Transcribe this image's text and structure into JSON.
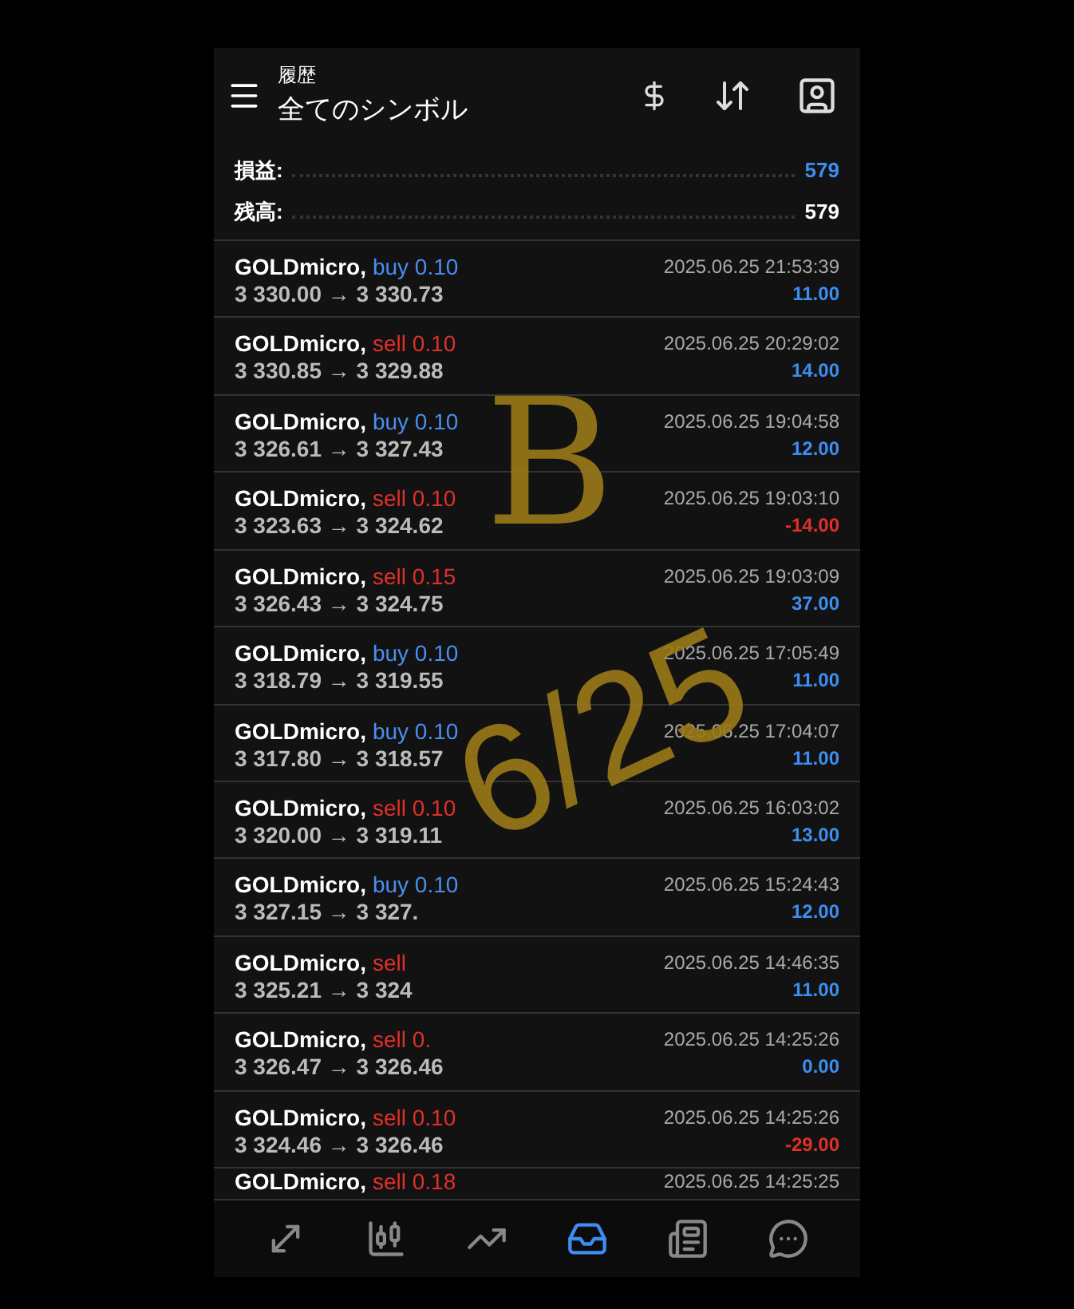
{
  "header": {
    "subtitle": "履歴",
    "title": "全てのシンボル"
  },
  "summary": [
    {
      "label": "損益:",
      "value": "579",
      "kind": "profit"
    },
    {
      "label": "残高:",
      "value": "579",
      "kind": "balance"
    }
  ],
  "deals": [
    {
      "symbol": "GOLDmicro,",
      "buy": true,
      "order": "buy 0.10",
      "prices": "3 330.00 → 3 330.73",
      "time": "2025.06.25 21:53:39",
      "profit": "11.00",
      "loss": false
    },
    {
      "symbol": "GOLDmicro,",
      "buy": false,
      "order": "sell 0.10",
      "prices": "3 330.85 → 3 329.88",
      "time": "2025.06.25 20:29:02",
      "profit": "14.00",
      "loss": false
    },
    {
      "symbol": "GOLDmicro,",
      "buy": true,
      "order": "buy 0.10",
      "prices": "3 326.61 → 3 327.43",
      "time": "2025.06.25 19:04:58",
      "profit": "12.00",
      "loss": false
    },
    {
      "symbol": "GOLDmicro,",
      "buy": false,
      "order": "sell 0.10",
      "prices": "3 323.63 → 3 324.62",
      "time": "2025.06.25 19:03:10",
      "profit": "-14.00",
      "loss": true
    },
    {
      "symbol": "GOLDmicro,",
      "buy": false,
      "order": "sell 0.15",
      "prices": "3 326.43 → 3 324.75",
      "time": "2025.06.25 19:03:09",
      "profit": "37.00",
      "loss": false
    },
    {
      "symbol": "GOLDmicro,",
      "buy": true,
      "order": "buy 0.10",
      "prices": "3 318.79 → 3 319.55",
      "time": "2025.06.25 17:05:49",
      "profit": "11.00",
      "loss": false
    },
    {
      "symbol": "GOLDmicro,",
      "buy": true,
      "order": "buy 0.10",
      "prices": "3 317.80 → 3 318.57",
      "time": "2025.06.25 17:04:07",
      "profit": "11.00",
      "loss": false
    },
    {
      "symbol": "GOLDmicro,",
      "buy": false,
      "order": "sell 0.10",
      "prices": "3 320.00 → 3 319.11",
      "time": "2025.06.25 16:03:02",
      "profit": "13.00",
      "loss": false
    },
    {
      "symbol": "GOLDmicro,",
      "buy": true,
      "order": "buy 0.10",
      "prices": "3 327.15 → 3 327.",
      "time": "2025.06.25 15:24:43",
      "profit": "12.00",
      "loss": false
    },
    {
      "symbol": "GOLDmicro,",
      "buy": false,
      "order": "sell",
      "prices": "3 325.21 → 3 324",
      "time": "2025.06.25 14:46:35",
      "profit": "11.00",
      "loss": false
    },
    {
      "symbol": "GOLDmicro,",
      "buy": false,
      "order": "sell 0.",
      "prices": "3 326.47 → 3 326.46",
      "time": "2025.06.25 14:25:26",
      "profit": "0.00",
      "loss": false
    },
    {
      "symbol": "GOLDmicro,",
      "buy": false,
      "order": "sell 0.10",
      "prices": "3 324.46 → 3 326.46",
      "time": "2025.06.25 14:25:26",
      "profit": "-29.00",
      "loss": true
    },
    {
      "symbol": "GOLDmicro,",
      "buy": false,
      "order": "sell 0.18",
      "time": "2025.06.25 14:25:25"
    }
  ],
  "annotation": {
    "letter": "B",
    "date": "6/25"
  },
  "nav": [
    {
      "kind": "trade",
      "selected": false
    },
    {
      "kind": "quotes",
      "selected": false
    },
    {
      "kind": "chart",
      "selected": false
    },
    {
      "kind": "history",
      "selected": true
    },
    {
      "kind": "news",
      "selected": false
    },
    {
      "kind": "chat",
      "selected": false
    }
  ]
}
